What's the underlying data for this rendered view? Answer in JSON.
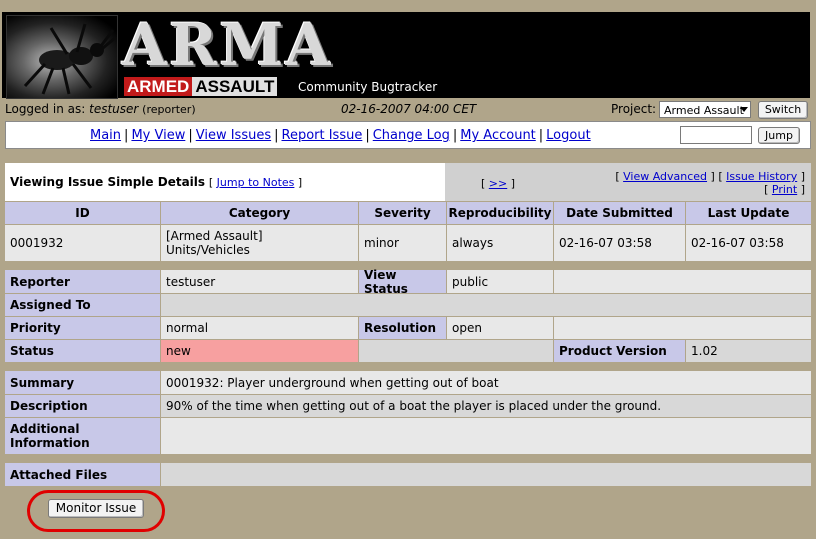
{
  "banner": {
    "logo_main": "ARMA",
    "logo_word1": "ARMED",
    "logo_word2": "ASSAULT",
    "subtitle": "Community Bugtracker"
  },
  "login": {
    "label": "Logged in as:",
    "username": "testuser",
    "role": "(reporter)",
    "datetime": "02-16-2007 04:00 CET",
    "project_label": "Project:",
    "project_selected": "Armed Assault",
    "switch_label": "Switch"
  },
  "nav": {
    "links": [
      "Main",
      "My View",
      "View Issues",
      "Report Issue",
      "Change Log",
      "My Account",
      "Logout"
    ],
    "jump_label": "Jump"
  },
  "issue": {
    "heading": "Viewing Issue Simple Details",
    "jump_notes": "Jump to Notes",
    "next_link": ">>",
    "view_advanced": "View Advanced",
    "issue_history": "Issue History",
    "print": "Print",
    "headers": [
      "ID",
      "Category",
      "Severity",
      "Reproducibility",
      "Date Submitted",
      "Last Update"
    ],
    "values": {
      "id": "0001932",
      "category_line1": "[Armed Assault]",
      "category_line2": "Units/Vehicles",
      "severity": "minor",
      "reproducibility": "always",
      "date_submitted": "02-16-07 03:58",
      "last_update": "02-16-07 03:58"
    },
    "reporter_label": "Reporter",
    "reporter": "testuser",
    "view_status_label": "View Status",
    "view_status": "public",
    "assigned_label": "Assigned To",
    "priority_label": "Priority",
    "priority": "normal",
    "resolution_label": "Resolution",
    "resolution": "open",
    "status_label": "Status",
    "status": "new",
    "product_version_label": "Product Version",
    "product_version": "1.02",
    "summary_label": "Summary",
    "summary": "0001932: Player underground when getting out of boat",
    "description_label": "Description",
    "description": "90% of the time when getting out of a boat the player is placed under the ground.",
    "additional_label_1": "Additional",
    "additional_label_2": "Information",
    "attached_label": "Attached Files",
    "monitor_label": "Monitor Issue"
  },
  "colors": {
    "page_bg": "#b0a58a",
    "header_bg": "#c8c8e8",
    "status_new": "#f7a0a0",
    "highlight_circle": "#e00000"
  }
}
